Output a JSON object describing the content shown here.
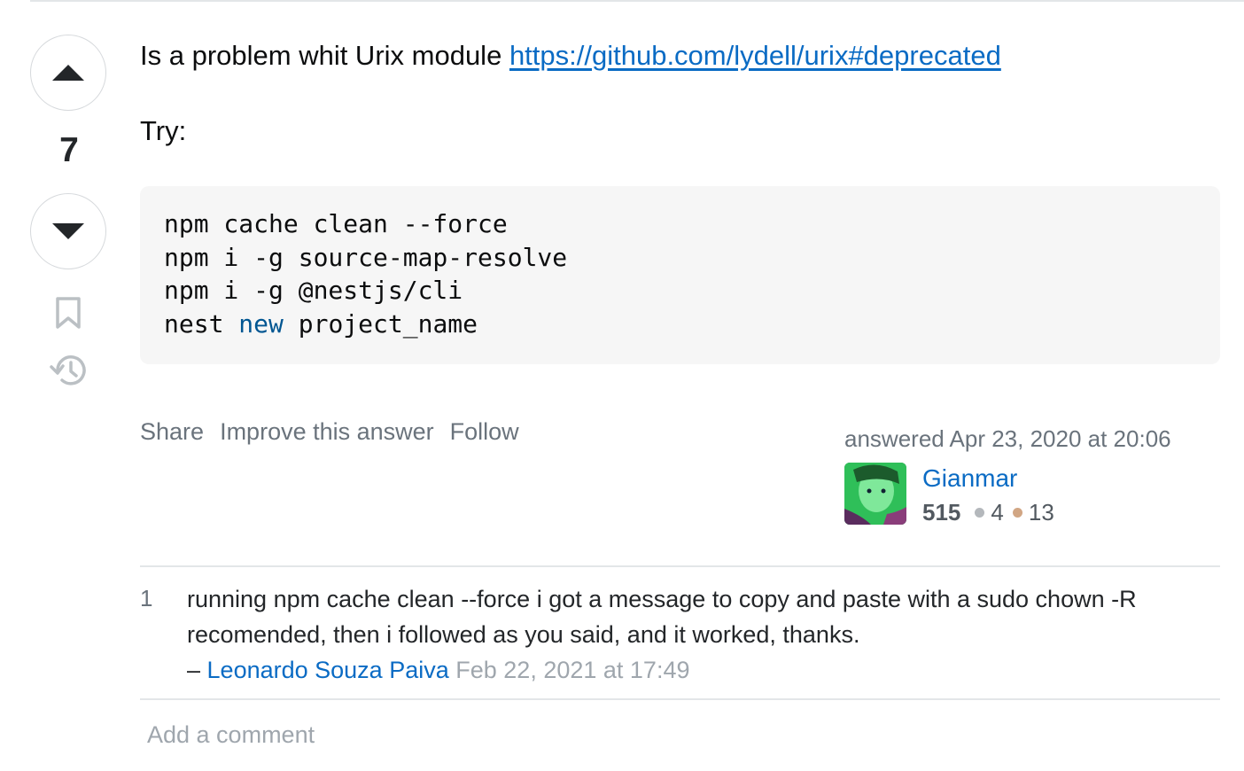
{
  "vote": {
    "count": "7"
  },
  "answer": {
    "line1_text": "Is a problem whit Urix module ",
    "link_text": "https://github.com/lydell/urix#deprecated",
    "line2_text": "Try:",
    "code_lines": [
      {
        "text": "npm cache clean --force"
      },
      {
        "text": "npm i -g source-map-resolve"
      },
      {
        "text": "npm i -g @nestjs/cli"
      },
      {
        "pre": "nest ",
        "keyword": "new",
        "post": " project_name"
      }
    ]
  },
  "post_menu": {
    "share": "Share",
    "improve": "Improve this answer",
    "follow": "Follow"
  },
  "user_card": {
    "action_time": "answered Apr 23, 2020 at 20:06",
    "name": "Gianmar",
    "reputation": "515",
    "silver_badges": "4",
    "bronze_badges": "13"
  },
  "comments": [
    {
      "score": "1",
      "text": "running npm cache clean --force i got a message to copy and paste with a sudo chown -R recomended, then i followed as you said, and it worked, thanks.",
      "dash": " – ",
      "user": "Leonardo Souza Paiva",
      "date": "Feb 22, 2021 at 17:49"
    }
  ],
  "add_comment": "Add a comment",
  "colors": {
    "link": "#0a6bc4",
    "muted": "#6a737c",
    "code_bg": "#f6f6f6",
    "code_keyword": "#015692",
    "silver": "#b4b8bc",
    "bronze": "#d1a684"
  },
  "icons": {
    "vote_up": "triangle-up-icon",
    "vote_down": "triangle-down-icon",
    "bookmark": "bookmark-icon",
    "history": "history-icon"
  }
}
